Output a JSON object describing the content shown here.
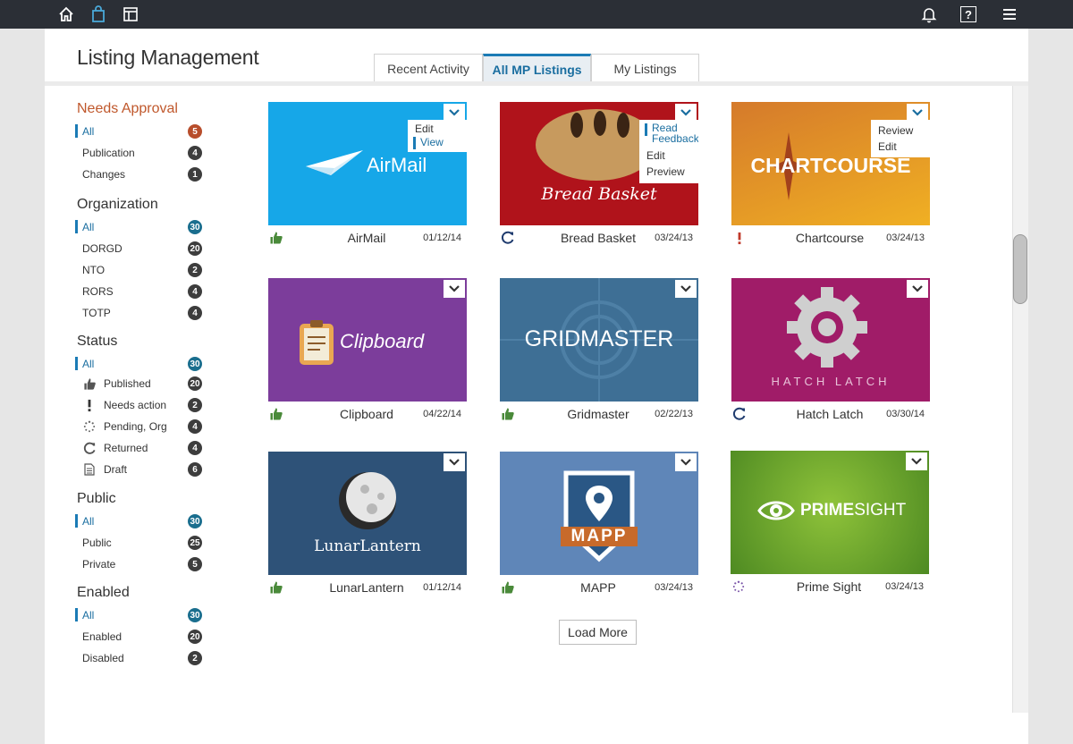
{
  "topbar": {
    "left_icons": [
      "home-icon",
      "bag-icon",
      "layout-icon"
    ],
    "right_icons": [
      "bell-icon",
      "help-icon",
      "menu-icon"
    ],
    "help_glyph": "?"
  },
  "page_title": "Listing Management",
  "tabs": [
    {
      "label": "Recent Activity",
      "active": false
    },
    {
      "label": "All MP Listings",
      "active": true
    },
    {
      "label": "My Listings",
      "active": false
    }
  ],
  "filters": {
    "needs_approval": {
      "title": "Needs Approval",
      "items": [
        {
          "label": "All",
          "count": "5"
        },
        {
          "label": "Publication",
          "count": "4"
        },
        {
          "label": "Changes",
          "count": "1"
        }
      ]
    },
    "organization": {
      "title": "Organization",
      "items": [
        {
          "label": "All",
          "count": "30"
        },
        {
          "label": "DORGD",
          "count": "20"
        },
        {
          "label": "NTO",
          "count": "2"
        },
        {
          "label": "RORS",
          "count": "4"
        },
        {
          "label": "TOTP",
          "count": "4"
        }
      ]
    },
    "status": {
      "title": "Status",
      "items": [
        {
          "label": "All",
          "count": "30"
        },
        {
          "label": "Published",
          "count": "20",
          "icon": "thumbs-up-icon"
        },
        {
          "label": "Needs action",
          "count": "2",
          "icon": "exclamation-icon"
        },
        {
          "label": "Pending, Org",
          "count": "4",
          "icon": "pending-icon"
        },
        {
          "label": "Returned",
          "count": "4",
          "icon": "returned-icon"
        },
        {
          "label": "Draft",
          "count": "6",
          "icon": "draft-icon"
        }
      ]
    },
    "public": {
      "title": "Public",
      "items": [
        {
          "label": "All",
          "count": "30"
        },
        {
          "label": "Public",
          "count": "25"
        },
        {
          "label": "Private",
          "count": "5"
        }
      ]
    },
    "enabled": {
      "title": "Enabled",
      "items": [
        {
          "label": "All",
          "count": "30"
        },
        {
          "label": "Enabled",
          "count": "20"
        },
        {
          "label": "Disabled",
          "count": "2"
        }
      ]
    }
  },
  "listings": [
    {
      "name": "AirMail",
      "date": "01/12/14",
      "status": "thumbs-up-icon",
      "logo_text": "AirMail",
      "color": "#16a7e8",
      "menu": [
        "Edit",
        "View"
      ]
    },
    {
      "name": "Bread Basket",
      "date": "03/24/13",
      "status": "returned-icon",
      "logo_text": "Bread Basket",
      "color": "#b0131b",
      "menu": [
        "Read Feedback",
        "Edit",
        "Preview"
      ]
    },
    {
      "name": "Chartcourse",
      "date": "03/24/13",
      "status": "exclamation-icon",
      "logo_text": "CHARTCOURSE",
      "color": "#e39a24",
      "menu": [
        "Review",
        "Edit"
      ]
    },
    {
      "name": "Clipboard",
      "date": "04/22/14",
      "status": "thumbs-up-icon",
      "logo_text": "Clipboard",
      "color": "#7c3d9b"
    },
    {
      "name": "Gridmaster",
      "date": "02/22/13",
      "status": "thumbs-up-icon",
      "logo_text": "GRIDMASTER",
      "color": "#3e6f95"
    },
    {
      "name": "Hatch Latch",
      "date": "03/30/14",
      "status": "returned-icon",
      "logo_text": "HATCH LATCH",
      "color": "#a01c68"
    },
    {
      "name": "LunarLantern",
      "date": "01/12/14",
      "status": "thumbs-up-icon",
      "logo_text": "LunarLantern",
      "color": "#2e5278"
    },
    {
      "name": "MAPP",
      "date": "03/24/13",
      "status": "thumbs-up-icon",
      "logo_text": "MAPP",
      "color": "#5f86b8"
    },
    {
      "name": "Prime Sight",
      "date": "03/24/13",
      "status": "pending-icon",
      "logo_text_a": "PRIME",
      "logo_text_b": "SIGHT",
      "color": "#6aa82c"
    }
  ],
  "load_more": "Load More",
  "colors": {
    "accent_blue": "#1b7bb5",
    "accent_orange": "#c0582c",
    "published_green": "#4a8a3a",
    "returned_navy": "#1f3b6e",
    "needs_action_red": "#c03a2b",
    "pending_purple": "#7a55a8"
  }
}
